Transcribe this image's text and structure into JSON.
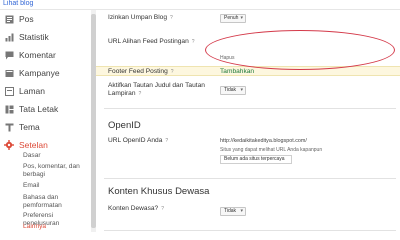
{
  "topbar": {
    "view_blog": "Lihat blog"
  },
  "sidebar": {
    "items": [
      {
        "label": "Pos",
        "icon": "posts-icon"
      },
      {
        "label": "Statistik",
        "icon": "stats-icon"
      },
      {
        "label": "Komentar",
        "icon": "comments-icon"
      },
      {
        "label": "Kampanye",
        "icon": "campaign-icon"
      },
      {
        "label": "Laman",
        "icon": "pages-icon"
      },
      {
        "label": "Tata Letak",
        "icon": "layout-icon"
      },
      {
        "label": "Tema",
        "icon": "theme-icon"
      },
      {
        "label": "Setelan",
        "icon": "settings-icon"
      }
    ],
    "sub_items": [
      {
        "label": "Dasar"
      },
      {
        "label": "Pos, komentar, dan berbagi"
      },
      {
        "label": "Email"
      },
      {
        "label": "Bahasa dan pemformatan"
      },
      {
        "label": "Preferensi penelusuran"
      },
      {
        "label": "Lainnya"
      }
    ],
    "accent_color": "#dd4b39"
  },
  "main": {
    "allow_feed": {
      "label": "Izinkan Umpan Blog",
      "help": "?",
      "value": "Penuh"
    },
    "post_feed_redirect": {
      "label": "URL Alihan Feed Postingan",
      "help": "?",
      "delete": "Hapus"
    },
    "post_feed_footer": {
      "label": "Footer Feed Posting",
      "help": "?",
      "action": "Tambahkan"
    },
    "title_links": {
      "label": "Aktifkan Tautan Judul dan Tautan Lampiran",
      "help": "?",
      "value": "Tidak"
    },
    "openid": {
      "title": "OpenID",
      "url_label": "URL OpenID Anda",
      "help": "?",
      "url_value": "http://kedaikitakeditya.blogspot.com/",
      "note": "Situs yang dapat melihat URL Anda kapanpun",
      "trusted_value": "Belum ada situs terpercaya"
    },
    "adult": {
      "title": "Konten Khusus Dewasa",
      "label": "Konten Dewasa?",
      "help": "?",
      "value": "Tidak"
    }
  },
  "highlight_color": "#d43a4a"
}
